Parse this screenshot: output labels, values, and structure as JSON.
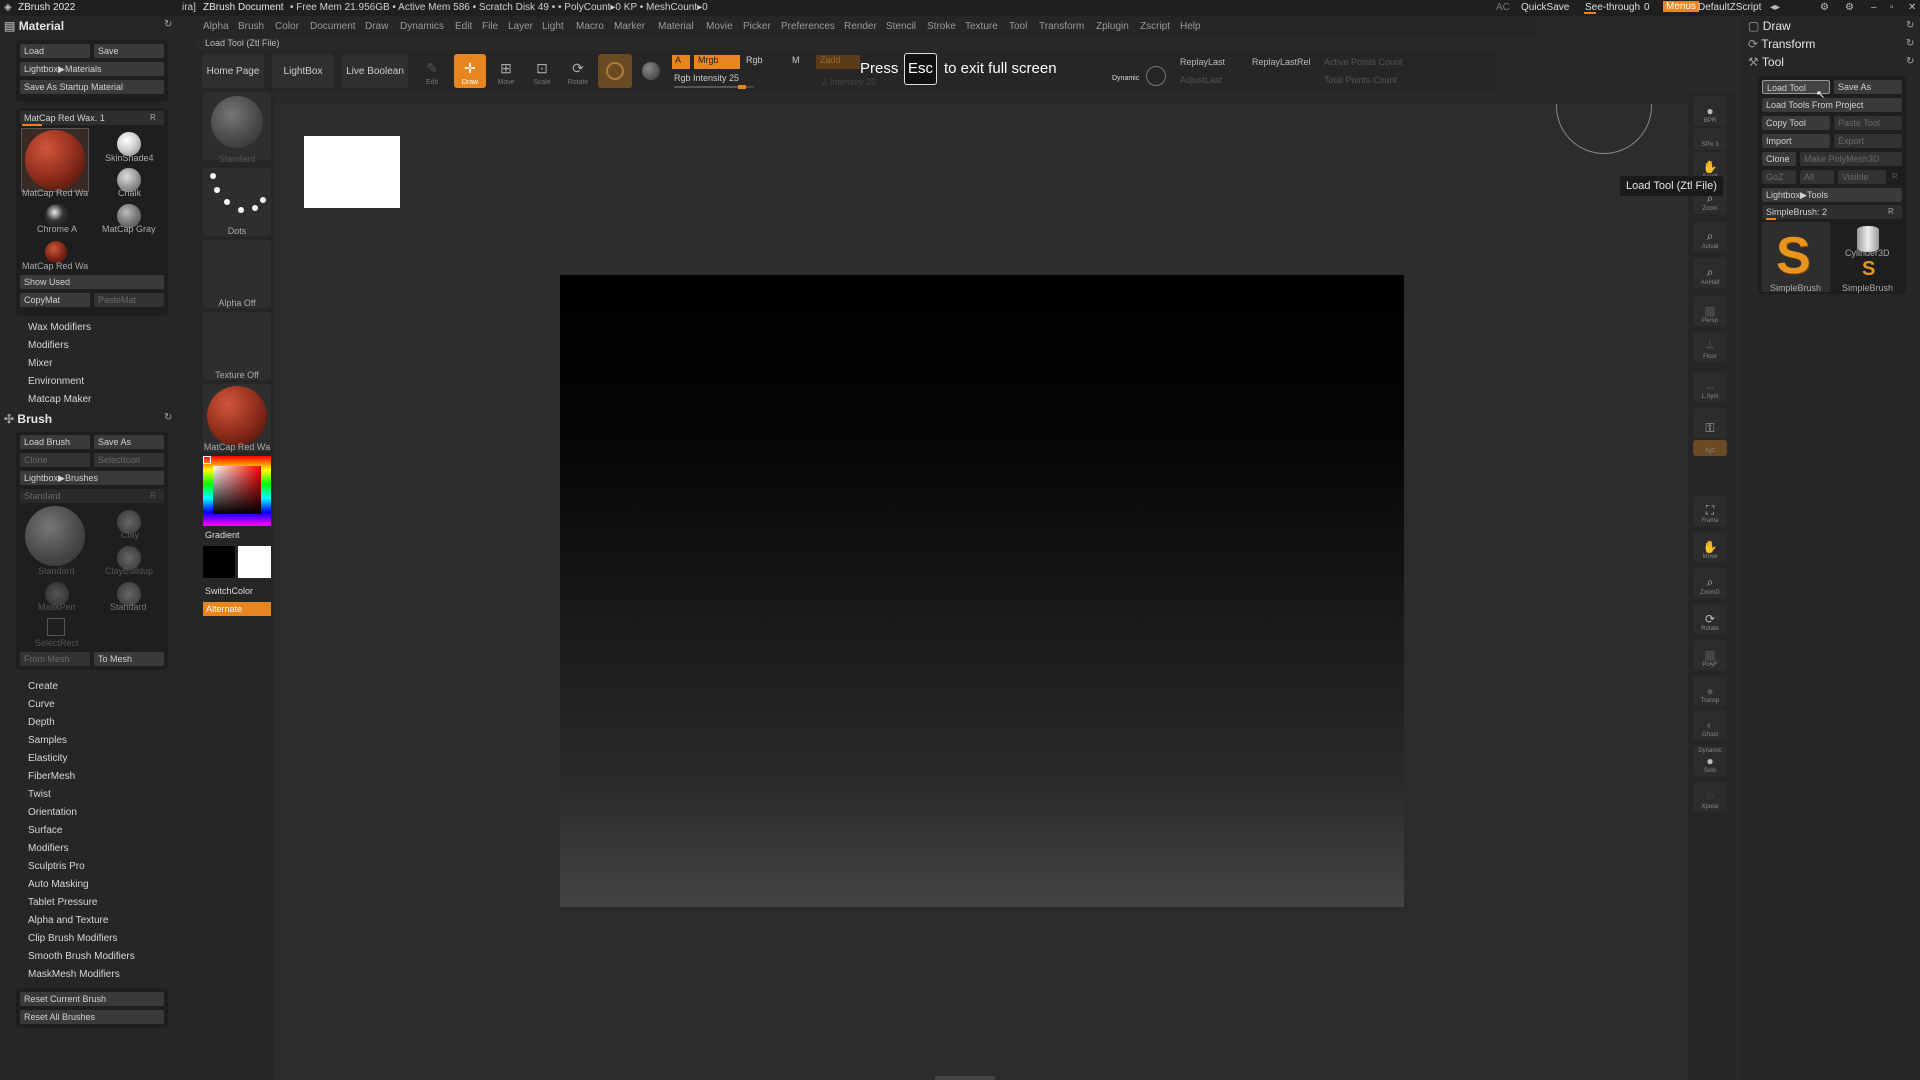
{
  "titlebar": {
    "app": "ZBrush 2022",
    "partial": "ira]",
    "doc": "ZBrush Document",
    "stats": "• Free Mem 21.956GB • Active Mem 586 • Scratch Disk 49 • • PolyCount▸0 KP • MeshCount▸0",
    "ac": "AC",
    "quicksave": "QuickSave",
    "seethrough": "See-through",
    "seethrough_val": "0",
    "menus": "Menus",
    "script": "DefaultZScript"
  },
  "menu": [
    "Alpha",
    "Brush",
    "Color",
    "Document",
    "Draw",
    "Dynamics",
    "Edit",
    "File",
    "Layer",
    "Light",
    "Macro",
    "Marker",
    "Material",
    "Movie",
    "Picker",
    "Preferences",
    "Render",
    "Stencil",
    "Stroke",
    "Texture",
    "Tool",
    "Transform",
    "Zplugin",
    "Zscript",
    "Help"
  ],
  "tool_hint": "Load Tool (Ztl File)",
  "shelf": {
    "home": "Home Page",
    "lightbox": "LightBox",
    "boolean": "Live Boolean",
    "edit": "Edit",
    "draw": "Draw",
    "move": "Move",
    "scale": "Scale",
    "rotate": "Rotate",
    "a": "A",
    "mrgb": "Mrgb",
    "rgb": "Rgb",
    "m": "M",
    "zadd": "Zadd",
    "rgb_intensity": "Rgb Intensity 25",
    "z_intensity": "Z Intensity 25",
    "dynamic": "Dynamic",
    "replay": "ReplayLast",
    "replayrel": "ReplayLastRel",
    "adjust": "AdjustLast",
    "active_points": "Active Points Count",
    "total_points": "Total Points Count"
  },
  "fullscreen": {
    "press": "Press",
    "key": "Esc",
    "rest": "to exit full screen"
  },
  "material": {
    "title": "Material",
    "load": "Load",
    "save": "Save",
    "lightbox": "Lightbox▶Materials",
    "startup": "Save As Startup Material",
    "current": "MatCap Red Wax. 1",
    "r": "R",
    "items": [
      "MatCap Red Wa",
      "SkinShade4",
      "Chalk",
      "Chrome A",
      "MatCap Gray",
      "MatCap Red Wa"
    ],
    "show_used": "Show Used",
    "copymat": "CopyMat",
    "pastemat": "PasteMat",
    "sections": [
      "Wax Modifiers",
      "Modifiers",
      "Mixer",
      "Environment",
      "Matcap Maker"
    ]
  },
  "brush": {
    "title": "Brush",
    "load": "Load Brush",
    "saveas": "Save As",
    "clone": "Clone",
    "selecticon": "SelectIcon",
    "lightbox": "Lightbox▶Brushes",
    "current": "Standard",
    "r": "R",
    "items": [
      "Standard",
      "Clay",
      "ClayBuildup",
      "MaskPen",
      "Standard",
      "SelectRect"
    ],
    "frommesh": "From Mesh",
    "tomesh": "To Mesh",
    "sections": [
      "Create",
      "Curve",
      "Depth",
      "Samples",
      "Elasticity",
      "FiberMesh",
      "Twist",
      "Orientation",
      "Surface",
      "Modifiers",
      "Sculptris Pro",
      "Auto Masking",
      "Tablet Pressure",
      "Alpha and Texture",
      "Clip Brush Modifiers",
      "Smooth Brush Modifiers",
      "MaskMesh Modifiers"
    ],
    "reset_current": "Reset Current Brush",
    "reset_all": "Reset All Brushes"
  },
  "mid": {
    "standard": "Standard",
    "dots": "Dots",
    "alpha_off": "Alpha Off",
    "texture_off": "Texture Off",
    "matcap": "MatCap Red Wa",
    "gradient": "Gradient",
    "switchcolor": "SwitchColor",
    "alternate": "Alternate"
  },
  "rightshelf": [
    "BPR",
    "SPix 3",
    "Scroll",
    "Zoom",
    "Actual",
    "AAHalf",
    "Persp",
    "Floor",
    "L.Sym",
    "",
    "Xyz",
    "",
    "",
    "Frame",
    "Move",
    "ZoomD",
    "Rotate",
    "PolyF",
    "Transp",
    "Ghost",
    "Dynamic",
    "Solo",
    "Xpose"
  ],
  "rightpanel": {
    "draw": "Draw",
    "transform": "Transform",
    "tool": "Tool",
    "load_tool": "Load Tool",
    "save_as": "Save As",
    "load_project": "Load Tools From Project",
    "copy_tool": "Copy Tool",
    "paste_tool": "Paste Tool",
    "import": "Import",
    "export": "Export",
    "clone": "Clone",
    "make_poly": "Make PolyMesh3D",
    "goz": "GoZ",
    "all": "All",
    "visible": "Visible",
    "r": "R",
    "lightbox": "Lightbox▶Tools",
    "simplebrush_slider": "SimpleBrush: 2",
    "tool_items": [
      "SimpleBrush",
      "Cylinder3D",
      "SimpleBrush"
    ]
  },
  "tooltip": "Load Tool (Ztl File)",
  "colors": {
    "accent": "#e8851f",
    "bg": "#262626"
  }
}
